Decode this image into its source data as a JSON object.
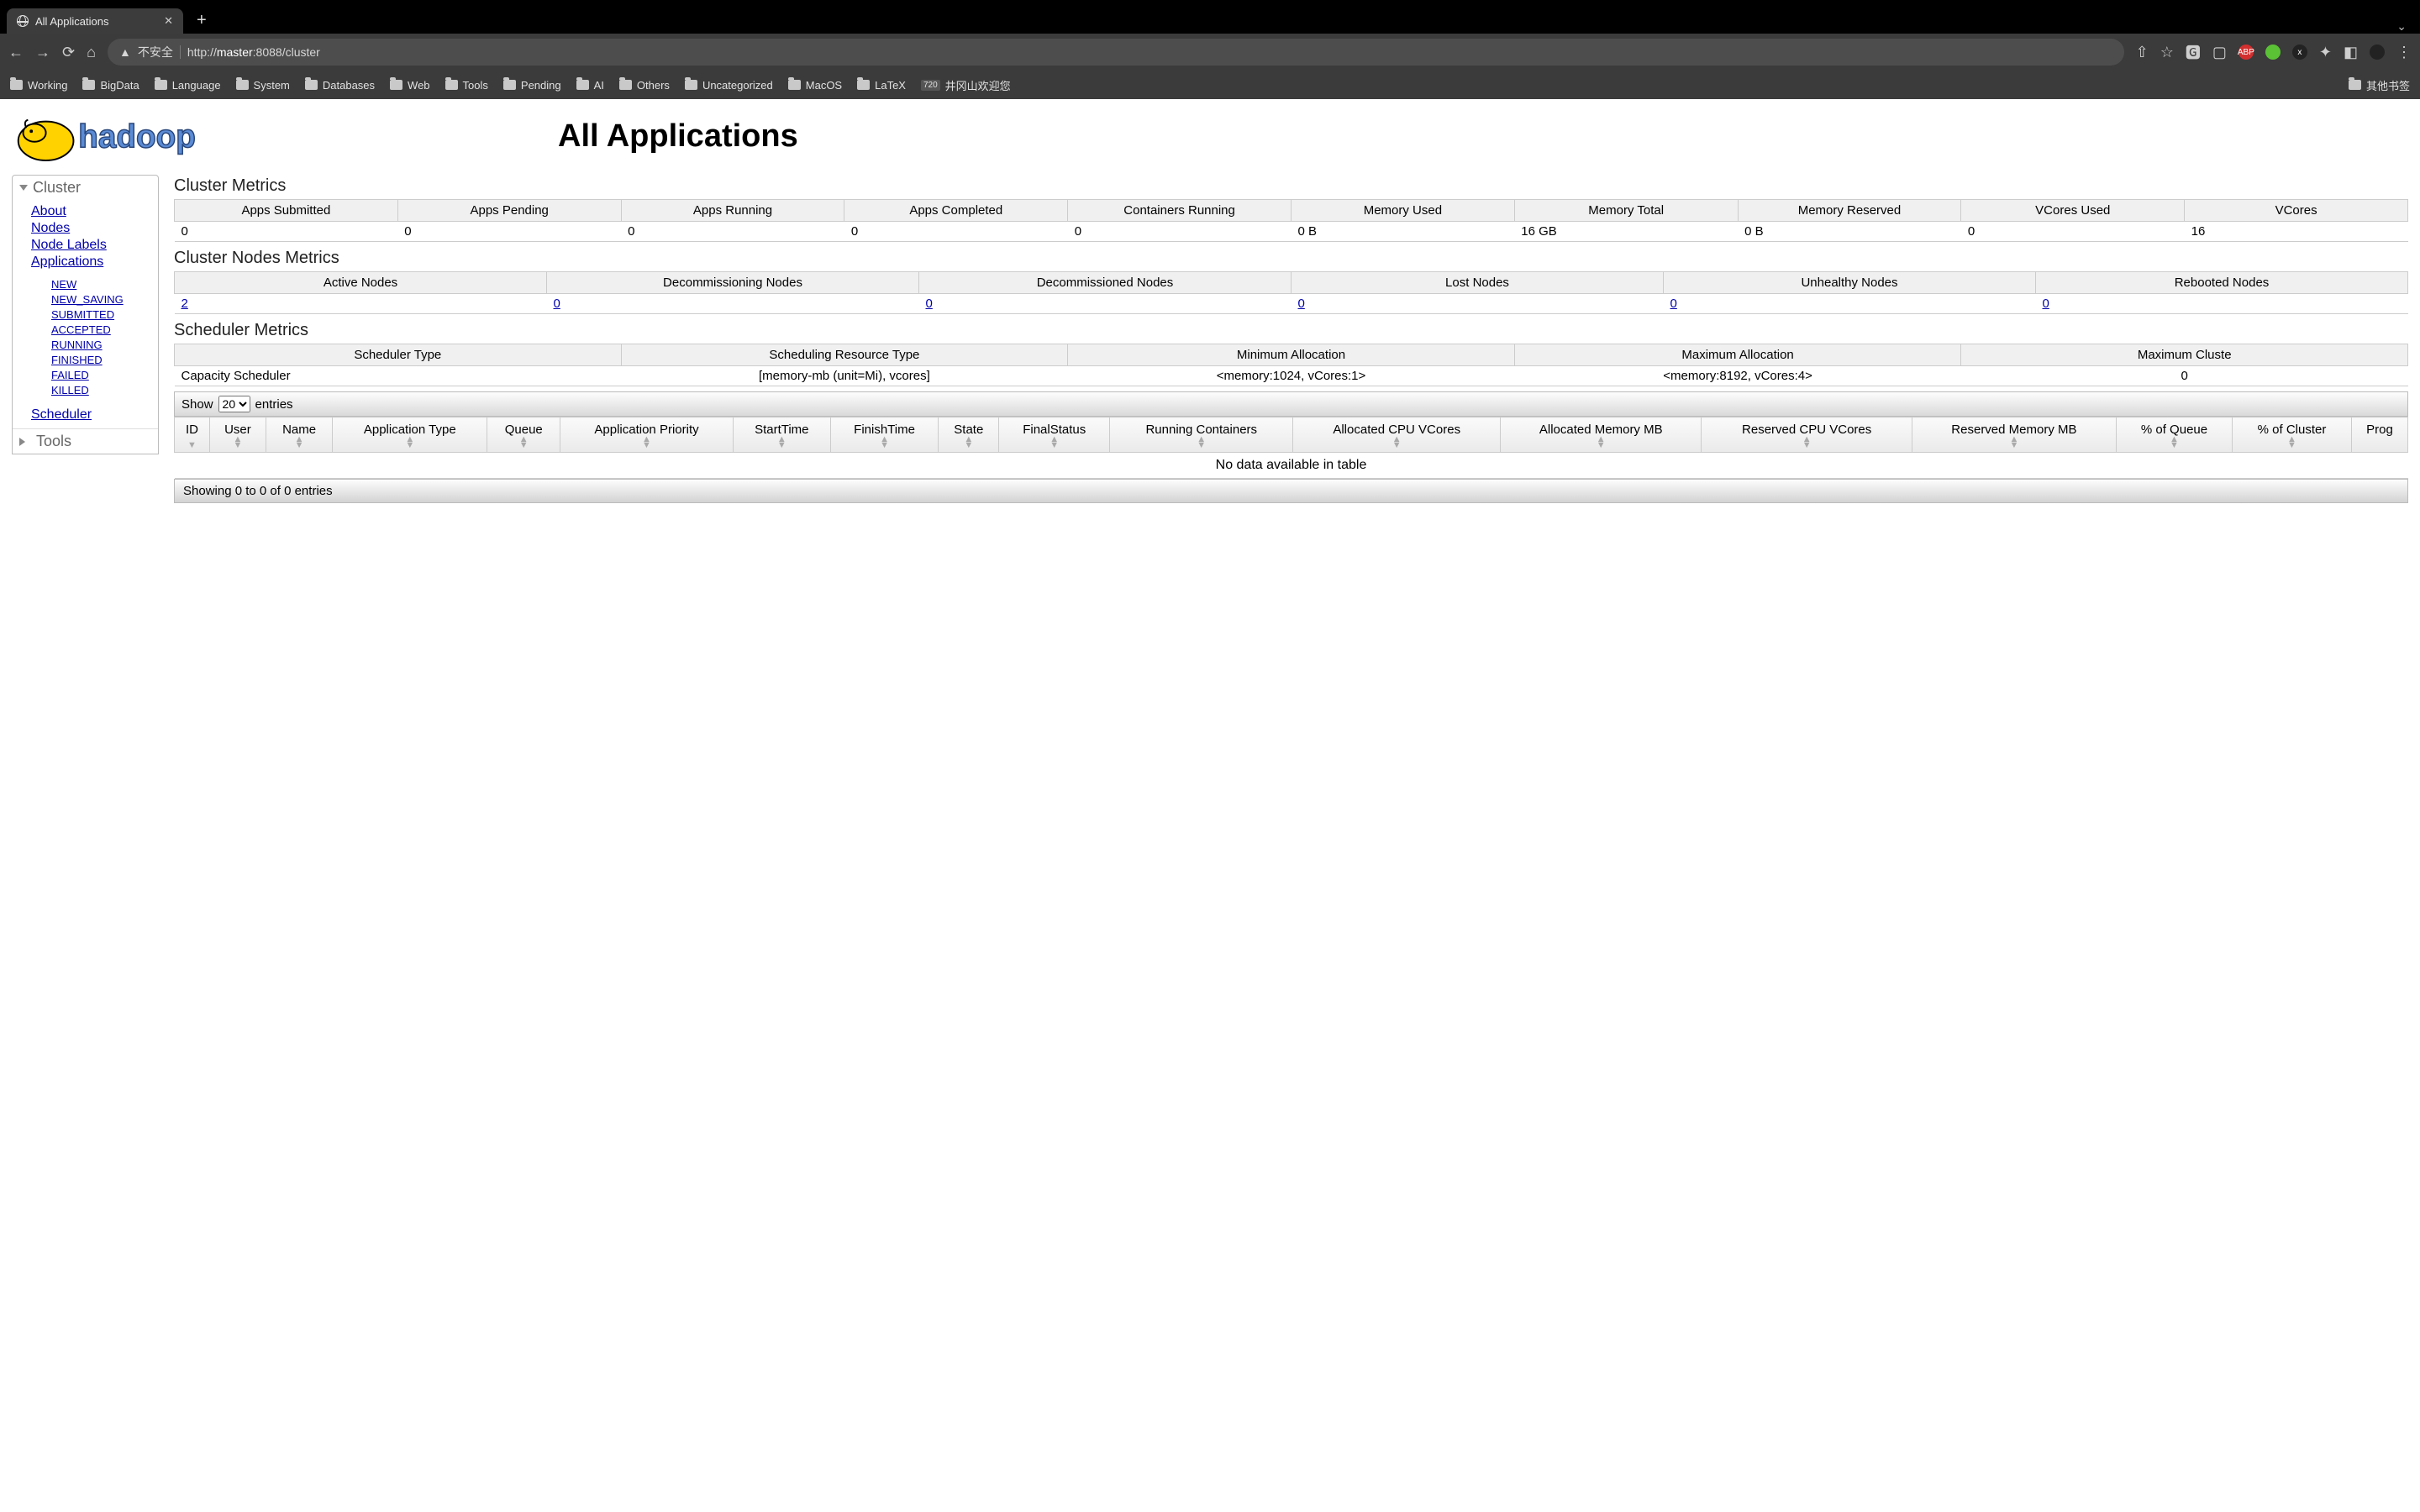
{
  "browser": {
    "tab_title": "All Applications",
    "url_insecure": "不安全",
    "url_display": "http://master:8088/cluster",
    "url_host_strong": "master",
    "bookmarks": [
      "Working",
      "BigData",
      "Language",
      "System",
      "Databases",
      "Web",
      "Tools",
      "Pending",
      "AI",
      "Others",
      "Uncategorized",
      "MacOS",
      "LaTeX"
    ],
    "bookmark_text_tail": "井冈山欢迎您",
    "bookmark_text_tail_badge": "720",
    "bookmarks_overflow": "其他书签"
  },
  "page": {
    "title": "All Applications",
    "logo_text": "hadoop"
  },
  "sidebar": {
    "sec1": "Cluster",
    "links1": [
      "About",
      "Nodes",
      "Node Labels",
      "Applications"
    ],
    "app_states": [
      "NEW",
      "NEW_SAVING",
      "SUBMITTED",
      "ACCEPTED",
      "RUNNING",
      "FINISHED",
      "FAILED",
      "KILLED"
    ],
    "scheduler_label": "Scheduler",
    "sec2": "Tools"
  },
  "cluster_metrics": {
    "heading": "Cluster Metrics",
    "headers": [
      "Apps Submitted",
      "Apps Pending",
      "Apps Running",
      "Apps Completed",
      "Containers Running",
      "Memory Used",
      "Memory Total",
      "Memory Reserved",
      "VCores Used",
      "VCores"
    ],
    "values": [
      "0",
      "0",
      "0",
      "0",
      "0",
      "0 B",
      "16 GB",
      "0 B",
      "0",
      "16"
    ]
  },
  "nodes_metrics": {
    "heading": "Cluster Nodes Metrics",
    "headers": [
      "Active Nodes",
      "Decommissioning Nodes",
      "Decommissioned Nodes",
      "Lost Nodes",
      "Unhealthy Nodes",
      "Rebooted Nodes"
    ],
    "values": [
      "2",
      "0",
      "0",
      "0",
      "0",
      "0"
    ]
  },
  "scheduler_metrics": {
    "heading": "Scheduler Metrics",
    "headers": [
      "Scheduler Type",
      "Scheduling Resource Type",
      "Minimum Allocation",
      "Maximum Allocation",
      "Maximum Cluste"
    ],
    "values": [
      "Capacity Scheduler",
      "[memory-mb (unit=Mi), vcores]",
      "<memory:1024, vCores:1>",
      "<memory:8192, vCores:4>",
      "0"
    ]
  },
  "datatable": {
    "show_label": "Show",
    "entries_label": "entries",
    "page_size": "20",
    "headers": [
      "ID",
      "User",
      "Name",
      "Application Type",
      "Queue",
      "Application Priority",
      "StartTime",
      "FinishTime",
      "State",
      "FinalStatus",
      "Running Containers",
      "Allocated CPU VCores",
      "Allocated Memory MB",
      "Reserved CPU VCores",
      "Reserved Memory MB",
      "% of Queue",
      "% of Cluster",
      "Prog"
    ],
    "no_data": "No data available in table",
    "footer": "Showing 0 to 0 of 0 entries"
  }
}
